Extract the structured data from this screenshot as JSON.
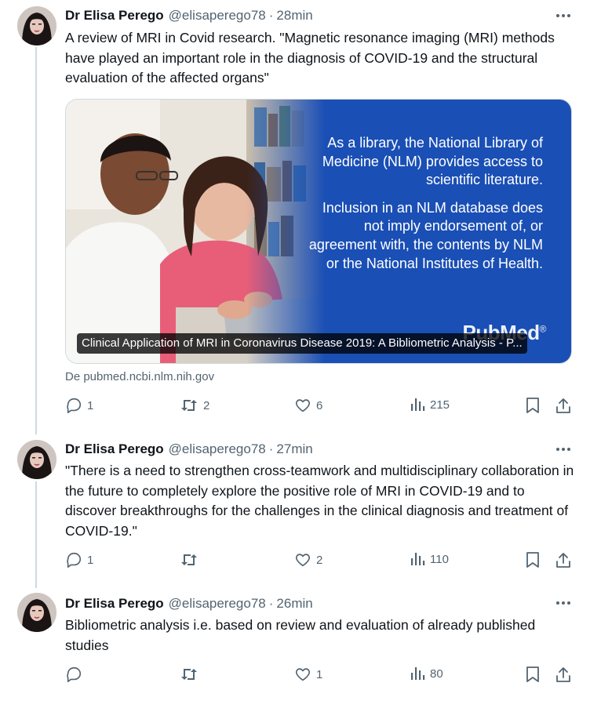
{
  "tweets": [
    {
      "author": "Dr Elisa Perego",
      "handle": "@elisaperego78",
      "separator": "·",
      "time": "28min",
      "text": "A review of MRI in Covid research. \"Magnetic resonance imaging (MRI) methods have played an important role in the diagnosis of COVID-19 and the structural evaluation of the affected organs\"",
      "card": {
        "overlay_paragraph_1": "As a library, the National Library of Medicine (NLM) provides access to scientific literature.",
        "overlay_paragraph_2": "Inclusion in an NLM database does not imply endorsement of, or agreement with, the contents by NLM or the National Institutes of Health.",
        "logo": "PubMed",
        "logo_mark": "®",
        "title": "Clinical Application of MRI in Coronavirus Disease 2019: A Bibliometric Analysis - P...",
        "source": "De pubmed.ncbi.nlm.nih.gov"
      },
      "replies": "1",
      "retweets": "2",
      "likes": "6",
      "views": "215"
    },
    {
      "author": "Dr Elisa Perego",
      "handle": "@elisaperego78",
      "separator": "·",
      "time": "27min",
      "text": "\"There is a need to strengthen cross-teamwork and multidisciplinary collaboration in the future to completely explore the positive role of MRI in COVID-19 and to discover breakthroughs for the challenges in the clinical diagnosis and treatment of COVID-19.\"",
      "replies": "1",
      "retweets": "",
      "likes": "2",
      "views": "110"
    },
    {
      "author": "Dr Elisa Perego",
      "handle": "@elisaperego78",
      "separator": "·",
      "time": "26min",
      "text": "Bibliometric analysis i.e. based on review and evaluation of already published studies",
      "replies": "",
      "retweets": "",
      "likes": "1",
      "views": "80"
    }
  ],
  "colors": {
    "text": "#0f1419",
    "secondary": "#536471",
    "thread_line": "#cfd9de",
    "card_blue": "#1a4fb5"
  },
  "icons": {
    "more": "more-horizontal-icon",
    "reply": "reply-icon",
    "retweet": "retweet-icon",
    "like": "heart-icon",
    "views": "views-bar-chart-icon",
    "bookmark": "bookmark-icon",
    "share": "share-icon"
  }
}
